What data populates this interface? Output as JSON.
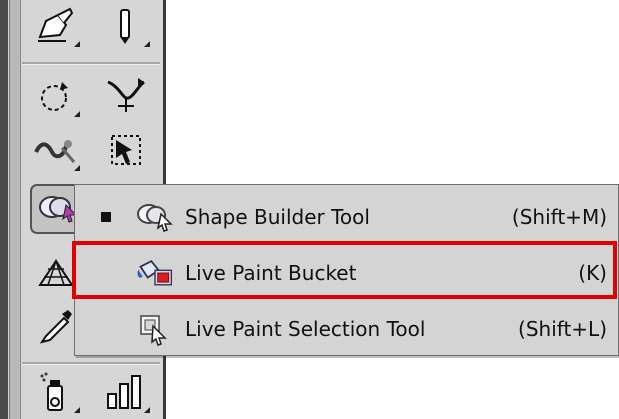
{
  "tools_panel": {
    "rows": [
      [
        "pen-drawing-tool-icon",
        "paint-tube-tool-icon"
      ],
      [
        "rotate-tool-icon",
        "width-puppet-tool-icon"
      ],
      [
        "warp-tool-icon",
        "free-transform-tool-icon"
      ],
      [
        "shape-builder-tool-icon",
        "live-paint-bucket-hidden-icon"
      ],
      [
        "perspective-grid-tool-icon",
        "blank-tool-slot"
      ],
      [
        "eyedropper-tool-icon",
        "blank-tool-slot"
      ],
      [
        "symbol-sprayer-tool-icon",
        "column-graph-tool-icon"
      ]
    ]
  },
  "flyout": {
    "items": [
      {
        "label": "Shape Builder Tool",
        "shortcut": "(Shift+M)",
        "icon": "shape-builder-icon",
        "selected": true
      },
      {
        "label": "Live Paint Bucket",
        "shortcut": "(K)",
        "icon": "live-paint-bucket-icon",
        "selected": false,
        "highlighted": true
      },
      {
        "label": "Live Paint Selection Tool",
        "shortcut": "(Shift+L)",
        "icon": "live-paint-selection-icon",
        "selected": false
      }
    ]
  },
  "colors": {
    "panel_bg": "#d6d6d6",
    "menu_bg": "#d4d4d4",
    "highlight_border": "#e30000",
    "text": "#111111"
  }
}
